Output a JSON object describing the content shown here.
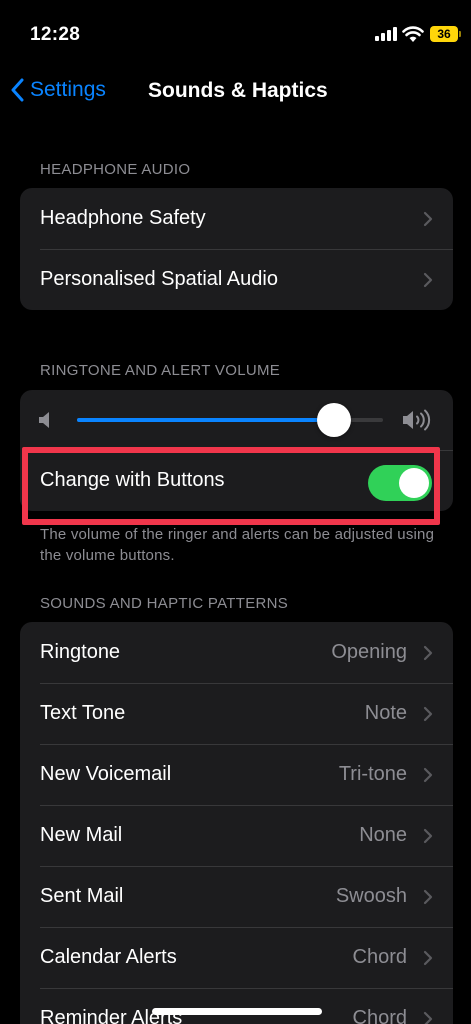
{
  "status_bar": {
    "time": "12:28",
    "battery": "36"
  },
  "nav": {
    "back_label": "Settings",
    "title": "Sounds & Haptics"
  },
  "headphone_audio": {
    "header": "HEADPHONE AUDIO",
    "items": [
      {
        "label": "Headphone Safety"
      },
      {
        "label": "Personalised Spatial Audio"
      }
    ]
  },
  "ringtone_volume": {
    "header": "RINGTONE AND ALERT VOLUME",
    "volume_level": 0.84,
    "change_with_buttons": {
      "label": "Change with Buttons",
      "on": true
    },
    "footer": "The volume of the ringer and alerts can be adjusted using the volume buttons."
  },
  "patterns": {
    "header": "SOUNDS AND HAPTIC PATTERNS",
    "items": [
      {
        "label": "Ringtone",
        "value": "Opening"
      },
      {
        "label": "Text Tone",
        "value": "Note"
      },
      {
        "label": "New Voicemail",
        "value": "Tri-tone"
      },
      {
        "label": "New Mail",
        "value": "None"
      },
      {
        "label": "Sent Mail",
        "value": "Swoosh"
      },
      {
        "label": "Calendar Alerts",
        "value": "Chord"
      },
      {
        "label": "Reminder Alerts",
        "value": "Chord"
      }
    ]
  },
  "colors": {
    "accent": "#0a84ff",
    "toggle_on": "#30d158",
    "highlight": "#f0364b"
  }
}
